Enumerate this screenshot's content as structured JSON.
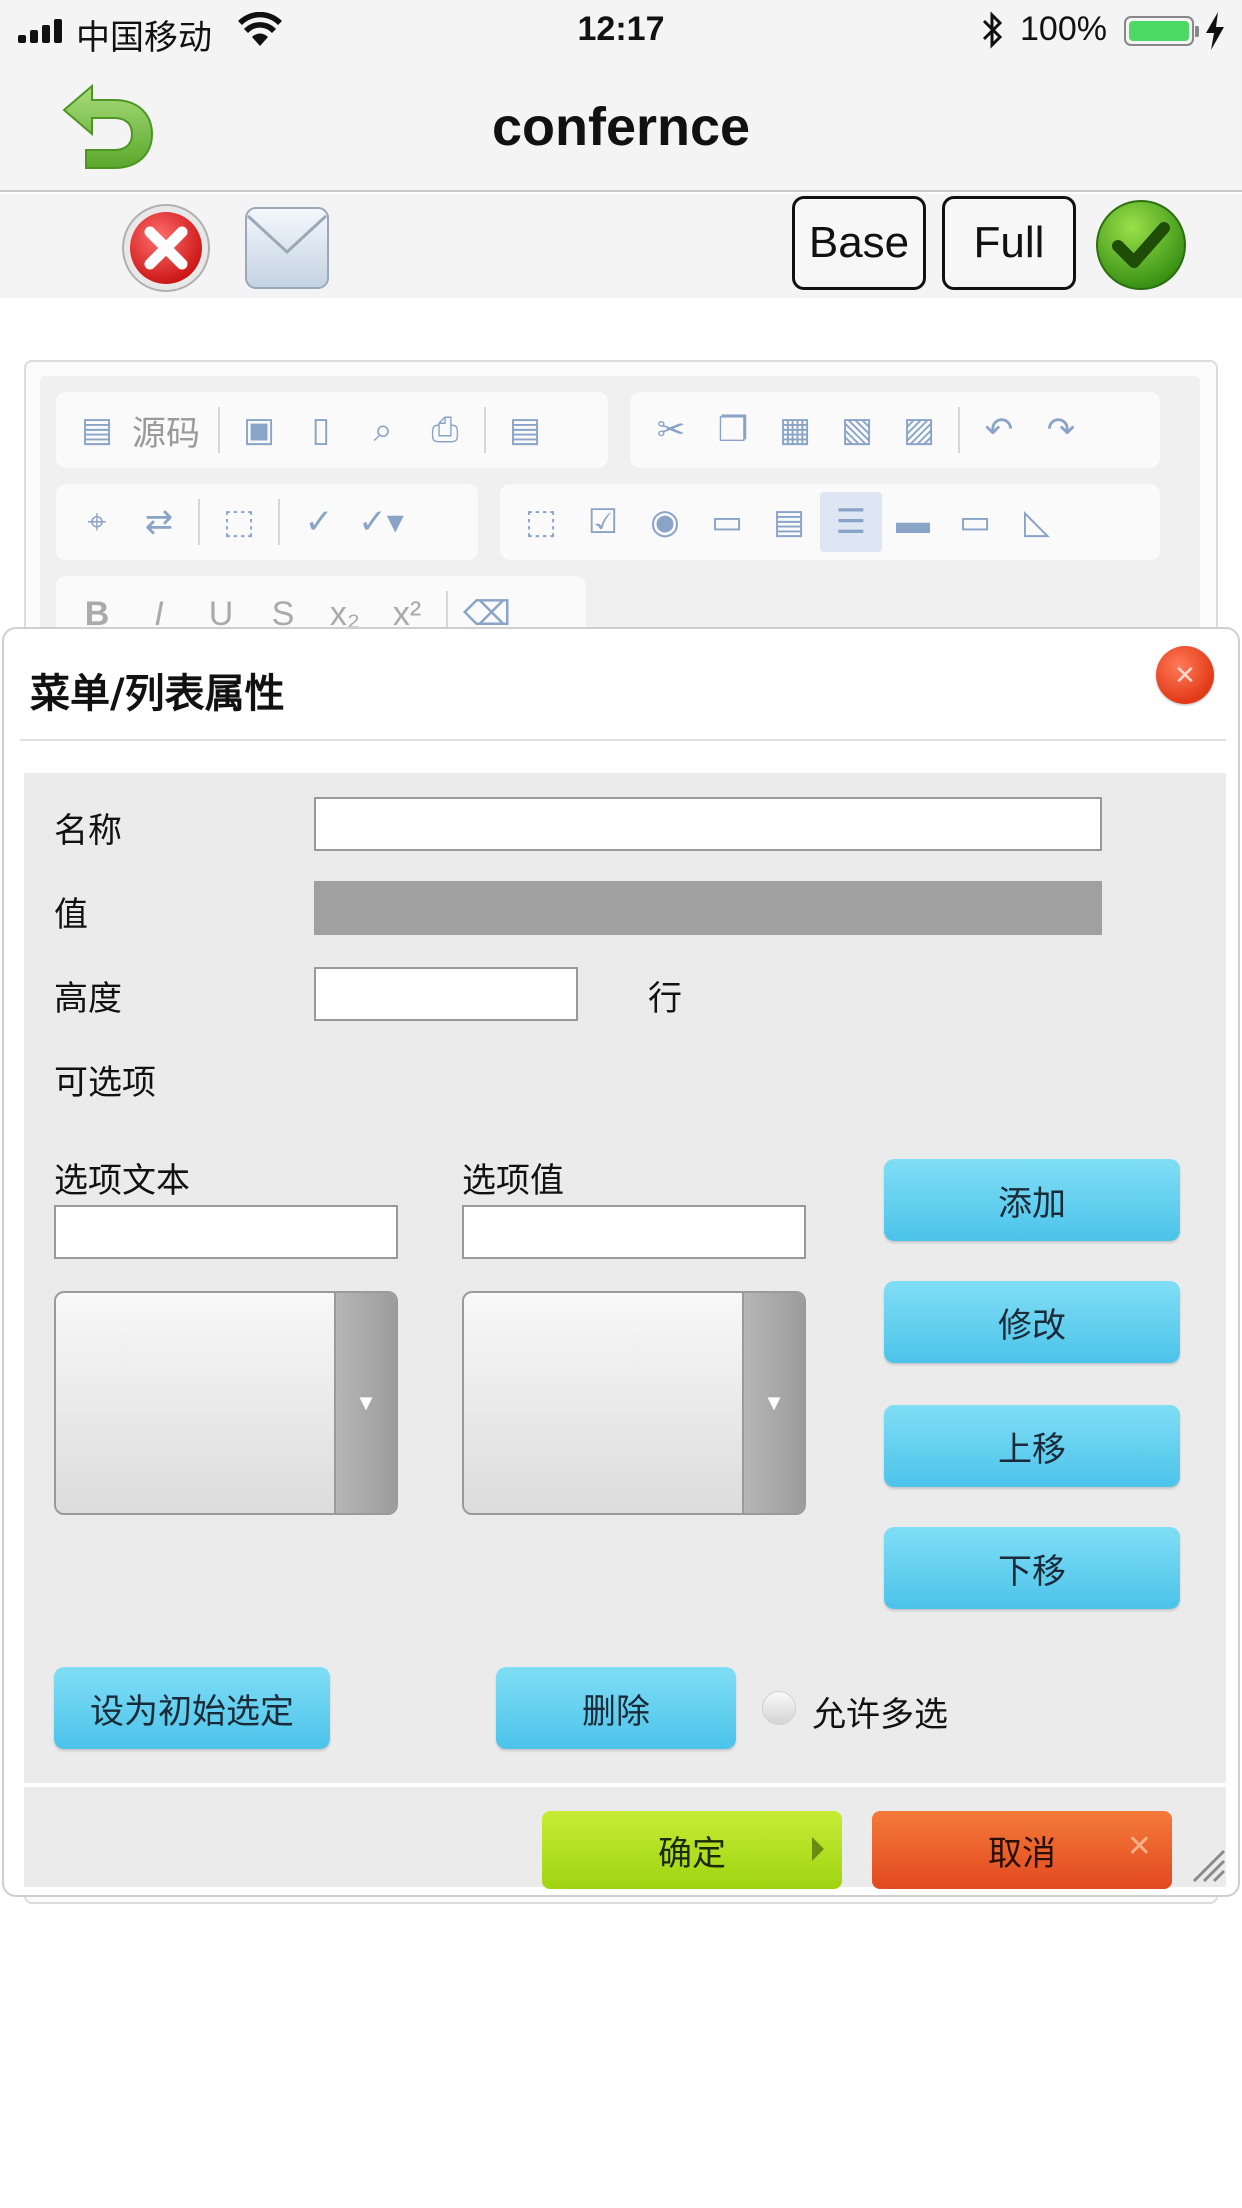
{
  "status_bar": {
    "carrier": "中国移动",
    "time": "12:17",
    "battery": "100%"
  },
  "nav": {
    "title": "confernce"
  },
  "toolbar": {
    "base_label": "Base",
    "full_label": "Full"
  },
  "editor_toolbar": {
    "source_label": "源码"
  },
  "dialog": {
    "title": "菜单/列表属性",
    "name_label": "名称",
    "name_value": "",
    "value_label": "值",
    "height_label": "高度",
    "height_value": "",
    "height_unit": "行",
    "options_label": "可选项",
    "option_text_label": "选项文本",
    "option_text_value": "",
    "option_value_label": "选项值",
    "option_value_value": "",
    "add_label": "添加",
    "modify_label": "修改",
    "move_up_label": "上移",
    "move_down_label": "下移",
    "set_default_label": "设为初始选定",
    "delete_label": "删除",
    "multi_select_label": "允许多选",
    "ok_label": "确定",
    "cancel_label": "取消"
  },
  "colors": {
    "accent_blue": "#4cc3ea",
    "ok_green": "#9fd411",
    "cancel_red": "#e2491f",
    "disabled_gray": "#a0a0a0"
  }
}
